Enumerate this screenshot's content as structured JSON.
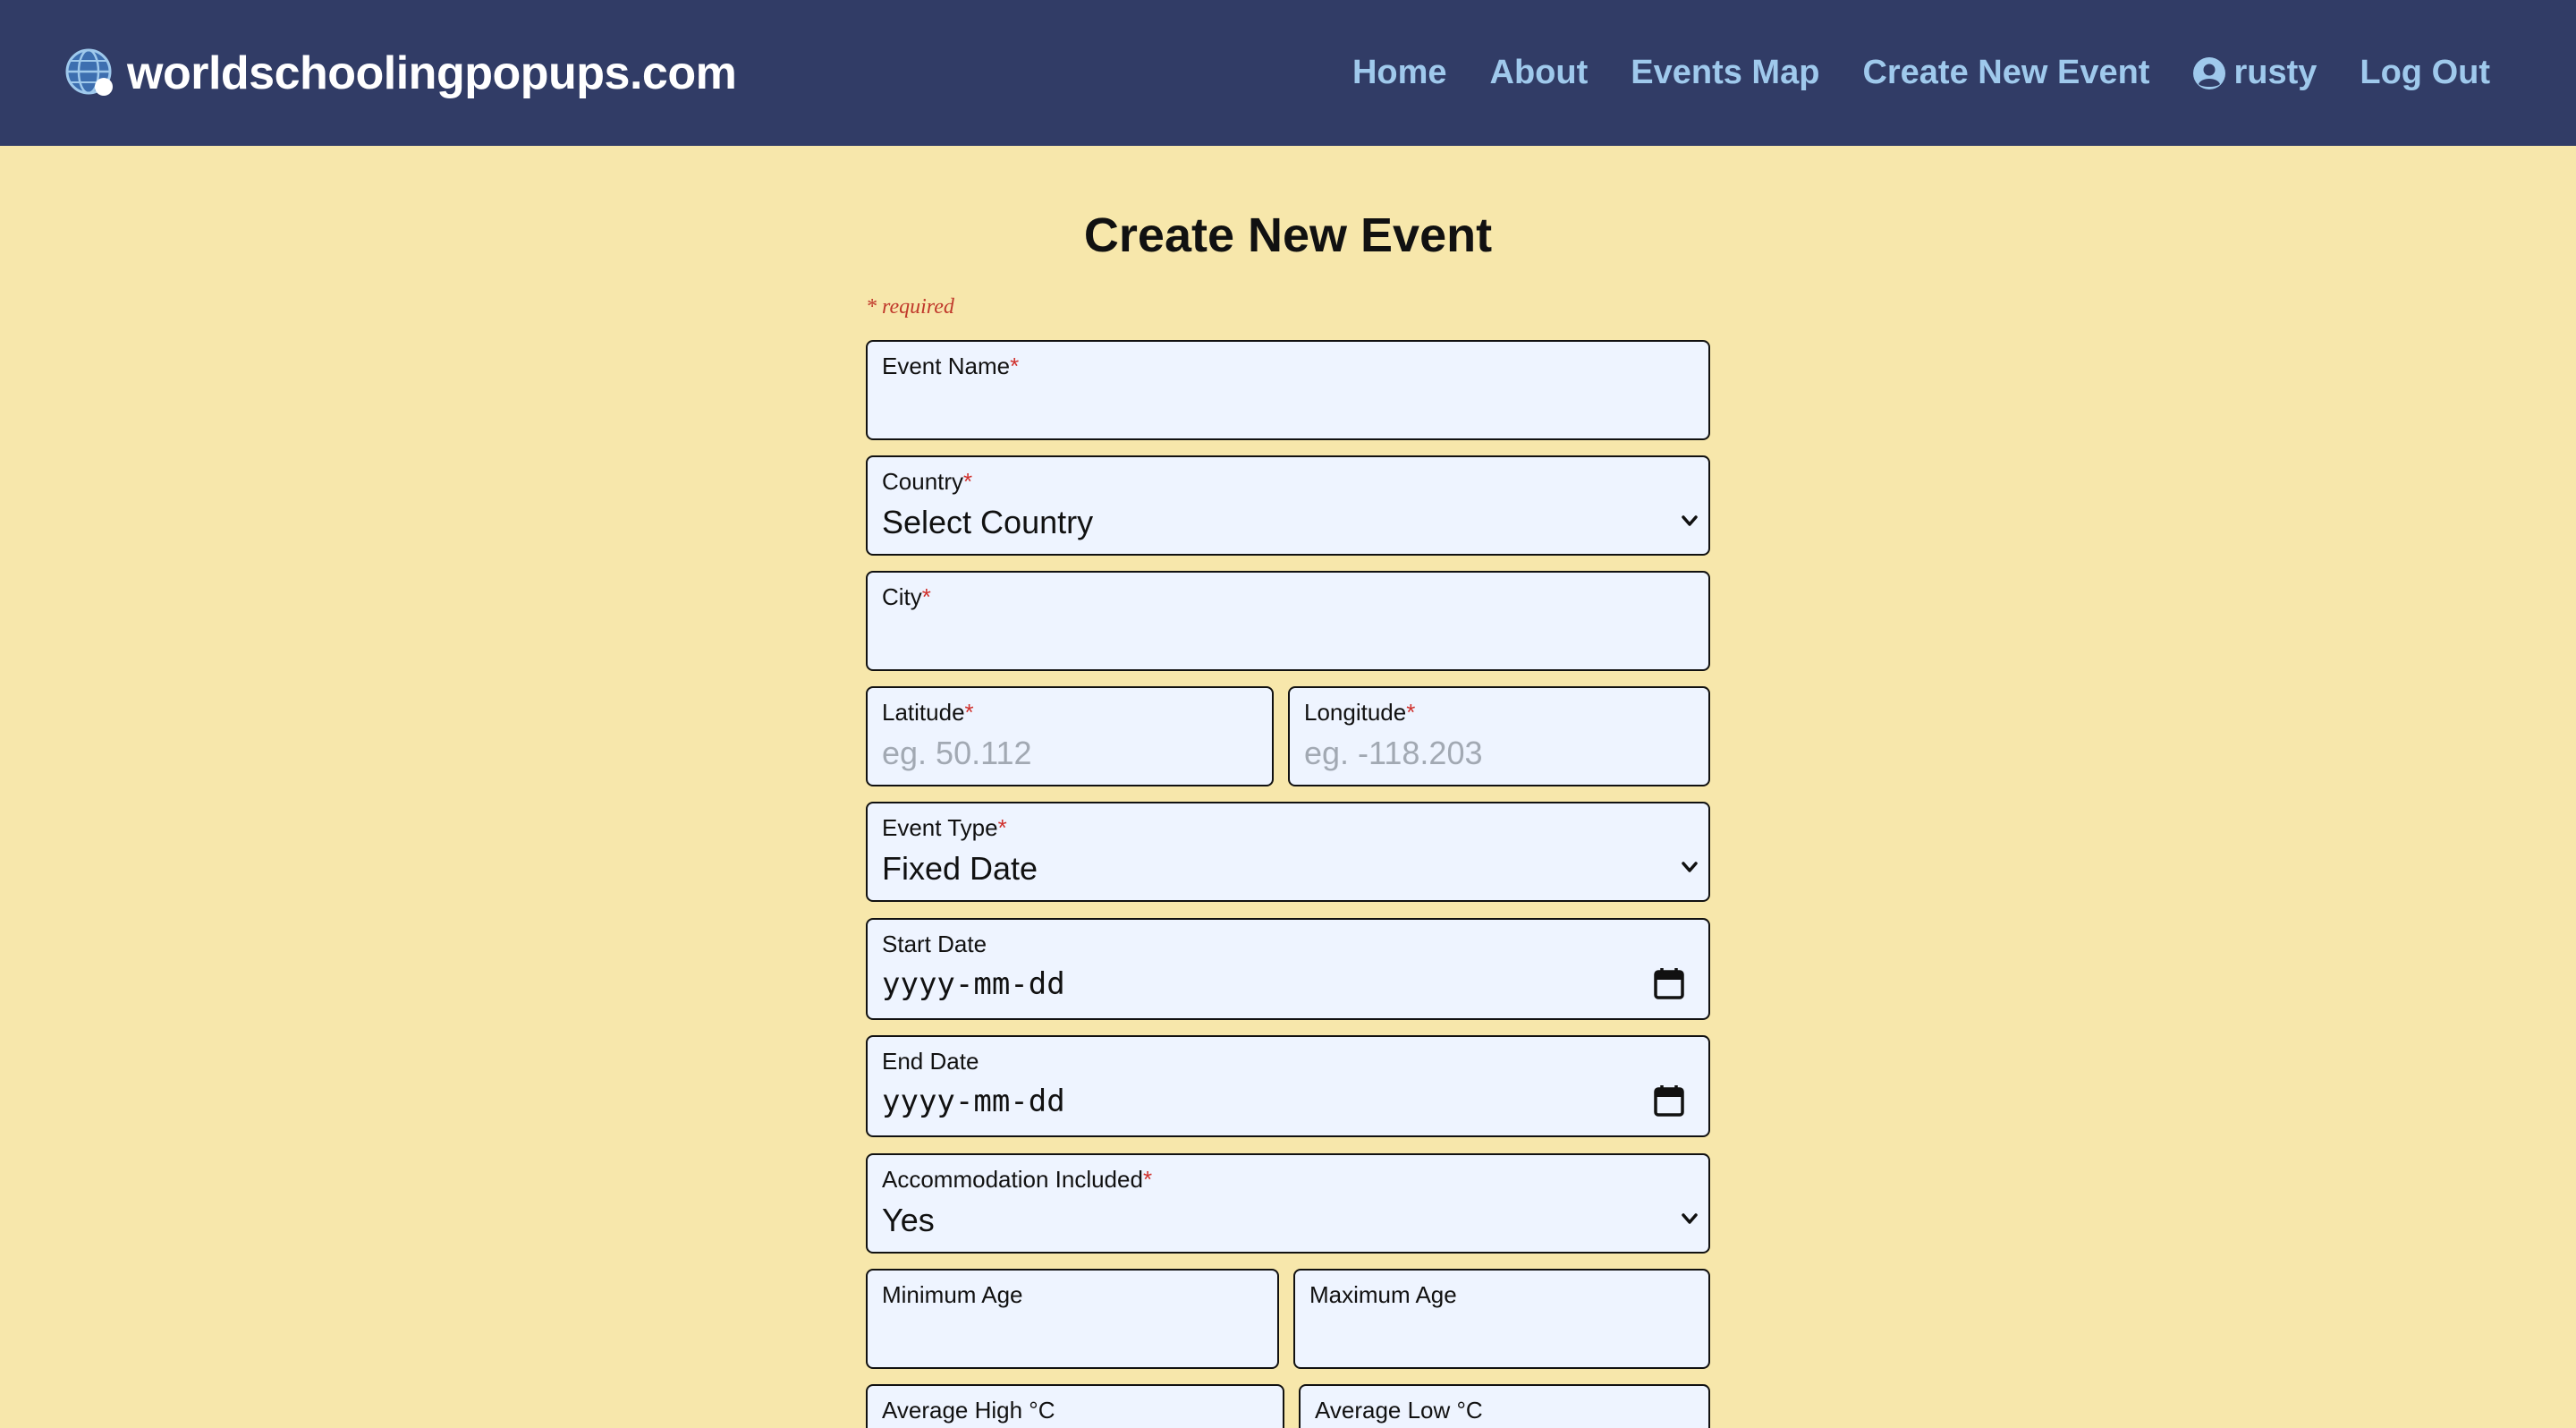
{
  "header": {
    "brand": "worldschoolingpopups.com",
    "nav": {
      "home": "Home",
      "about": "About",
      "events_map": "Events Map",
      "create_new_event": "Create New Event",
      "user": "rusty",
      "logout": "Log Out"
    }
  },
  "page": {
    "title": "Create New Event",
    "required_note": "* required"
  },
  "form": {
    "event_name": {
      "label": "Event Name",
      "value": ""
    },
    "country": {
      "label": "Country",
      "selected": "Select Country"
    },
    "city": {
      "label": "City",
      "value": ""
    },
    "latitude": {
      "label": "Latitude",
      "placeholder": "eg. 50.112"
    },
    "longitude": {
      "label": "Longitude",
      "placeholder": "eg. -118.203"
    },
    "event_type": {
      "label": "Event Type",
      "selected": "Fixed Date"
    },
    "start_date": {
      "label": "Start Date",
      "placeholder": "yyyy-mm-dd"
    },
    "end_date": {
      "label": "End Date",
      "placeholder": "yyyy-mm-dd"
    },
    "accommodation": {
      "label": "Accommodation Included",
      "selected": "Yes"
    },
    "min_age": {
      "label": "Minimum Age",
      "value": ""
    },
    "max_age": {
      "label": "Maximum Age",
      "value": ""
    },
    "avg_high": {
      "label": "Average High °C",
      "value": ""
    },
    "avg_low": {
      "label": "Average Low °C",
      "value": ""
    },
    "required_marker": "*"
  },
  "colors": {
    "header_bg": "#313c66",
    "page_bg": "#f7e7ab",
    "nav_link": "#9fc9ec",
    "field_bg": "#eef4ff",
    "required": "#d0312d"
  },
  "icons": {
    "brand": "globe-icon",
    "user": "user-circle-icon",
    "select": "chevron-down-icon",
    "date": "calendar-icon"
  }
}
